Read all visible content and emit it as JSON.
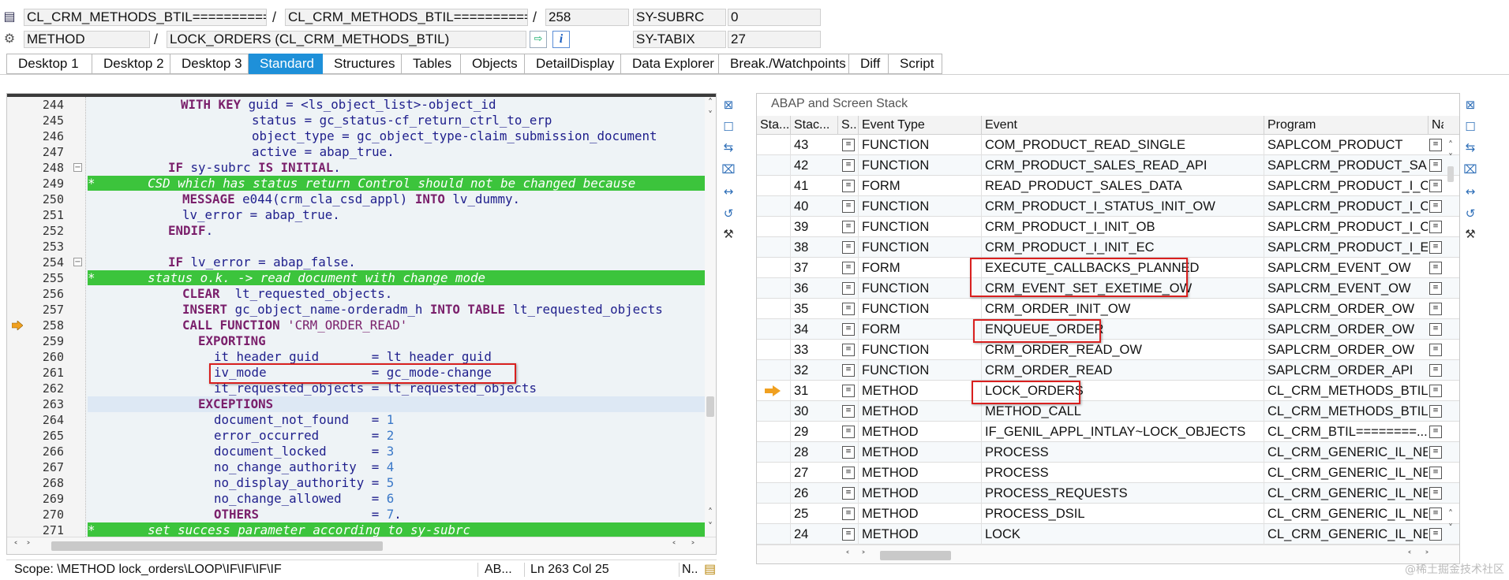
{
  "header": {
    "row1": {
      "field1": "CL_CRM_METHODS_BTIL==========...",
      "sep1": "/",
      "field2": "CL_CRM_METHODS_BTIL==========...",
      "sep2": "/",
      "field3": "258",
      "var_name": "SY-SUBRC",
      "var_value": "0"
    },
    "row2": {
      "field1": "METHOD",
      "sep1": "/",
      "field2": "LOCK_ORDERS (CL_CRM_METHODS_BTIL)",
      "info_glyph": "i",
      "var_name": "SY-TABIX",
      "var_value": "27"
    }
  },
  "tabs": [
    {
      "label": "Desktop 1"
    },
    {
      "label": "Desktop 2"
    },
    {
      "label": "Desktop 3"
    },
    {
      "label": "Standard"
    },
    {
      "label": "Structures"
    },
    {
      "label": "Tables"
    },
    {
      "label": "Objects"
    },
    {
      "label": "DetailDisplay"
    },
    {
      "label": "Data Explorer"
    },
    {
      "label": "Break./Watchpoints"
    },
    {
      "label": "Diff"
    },
    {
      "label": "Script"
    }
  ],
  "active_tab": "Standard",
  "editor": {
    "line_numbers": [
      "244",
      "245",
      "246",
      "247",
      "248",
      "249",
      "250",
      "251",
      "252",
      "253",
      "254",
      "255",
      "256",
      "257",
      "258",
      "259",
      "260",
      "261",
      "262",
      "263",
      "264",
      "265",
      "266",
      "267",
      "268",
      "269",
      "270",
      "271"
    ],
    "lines": {
      "l244": {
        "a": "WITH KEY",
        "b": " guid = <ls_object_list>-object_id"
      },
      "l245": {
        "b": "status = gc_status-cf_return_ctrl_to_erp"
      },
      "l246": {
        "b": "object_type = gc_object_type-claim_submission_document"
      },
      "l247": {
        "b": "active = abap_true."
      },
      "l248": {
        "a": "IF",
        "b": " sy-subrc ",
        "c": "IS INITIAL",
        "d": "."
      },
      "l249": {
        "b": "*       CSD which has status return Control should not be changed because"
      },
      "l250": {
        "a": "MESSAGE",
        "b": " e044(crm_cla_csd_appl) ",
        "c": "INTO",
        "d": " lv_dummy."
      },
      "l251": {
        "b": "lv_error = abap_true."
      },
      "l252": {
        "a": "ENDIF",
        "b": "."
      },
      "l254": {
        "a": "IF",
        "b": " lv_error = abap_false."
      },
      "l255": {
        "b": "*       status o.k. -> read document with change mode"
      },
      "l256": {
        "a": "CLEAR",
        "b": "  lt_requested_objects."
      },
      "l257": {
        "a": "INSERT",
        "b": " gc_object_name-orderadm_h ",
        "c": "INTO TABLE",
        "d": " lt_requested_objects"
      },
      "l258": {
        "a": "CALL FUNCTION",
        "b": " 'CRM_ORDER_READ'"
      },
      "l259": {
        "a": "EXPORTING"
      },
      "l260": {
        "b": "it_header_guid       = lt_header_guid"
      },
      "l261": {
        "b": "iv_mode              = gc_mode-change"
      },
      "l262": {
        "b": "it_requested_objects = lt_requested_objects"
      },
      "l263": {
        "a": "EXCEPTIONS"
      },
      "l264": {
        "b": "document_not_found   = ",
        "n": "1"
      },
      "l265": {
        "b": "error_occurred       = ",
        "n": "2"
      },
      "l266": {
        "b": "document_locked      = ",
        "n": "3"
      },
      "l267": {
        "b": "no_change_authority  = ",
        "n": "4"
      },
      "l268": {
        "b": "no_display_authority = ",
        "n": "5"
      },
      "l269": {
        "b": "no_change_allowed    = ",
        "n": "6"
      },
      "l270": {
        "a": "OTHERS",
        "b": "               = ",
        "n": "7",
        "d": "."
      },
      "l271": {
        "b": "*       set success parameter according to sy-subrc"
      }
    }
  },
  "statusbar": {
    "scope": "Scope: \\METHOD lock_orders\\LOOP\\IF\\IF\\IF\\IF",
    "mode": "AB...",
    "position": "Ln 263 Col  25",
    "ins": "N.."
  },
  "stack": {
    "title": "ABAP and Screen Stack",
    "columns": [
      "Sta...",
      "Stac...",
      "S...",
      "Event Type",
      "Event",
      "Program",
      "Na"
    ],
    "current_row": "31",
    "rows": [
      {
        "level": "43",
        "type": "FUNCTION",
        "event": "COM_PRODUCT_READ_SINGLE",
        "program": "SAPLCOM_PRODUCT"
      },
      {
        "level": "42",
        "type": "FUNCTION",
        "event": "CRM_PRODUCT_SALES_READ_API",
        "program": "SAPLCRM_PRODUCT_SALE..."
      },
      {
        "level": "41",
        "type": "FORM",
        "event": "READ_PRODUCT_SALES_DATA",
        "program": "SAPLCRM_PRODUCT_I_OW"
      },
      {
        "level": "40",
        "type": "FUNCTION",
        "event": "CRM_PRODUCT_I_STATUS_INIT_OW",
        "program": "SAPLCRM_PRODUCT_I_OW"
      },
      {
        "level": "39",
        "type": "FUNCTION",
        "event": "CRM_PRODUCT_I_INIT_OB",
        "program": "SAPLCRM_PRODUCT_I_OB"
      },
      {
        "level": "38",
        "type": "FUNCTION",
        "event": "CRM_PRODUCT_I_INIT_EC",
        "program": "SAPLCRM_PRODUCT_I_EC"
      },
      {
        "level": "37",
        "type": "FORM",
        "event": "EXECUTE_CALLBACKS_PLANNED",
        "program": "SAPLCRM_EVENT_OW"
      },
      {
        "level": "36",
        "type": "FUNCTION",
        "event": "CRM_EVENT_SET_EXETIME_OW",
        "program": "SAPLCRM_EVENT_OW"
      },
      {
        "level": "35",
        "type": "FUNCTION",
        "event": "CRM_ORDER_INIT_OW",
        "program": "SAPLCRM_ORDER_OW"
      },
      {
        "level": "34",
        "type": "FORM",
        "event": "ENQUEUE_ORDER",
        "program": "SAPLCRM_ORDER_OW"
      },
      {
        "level": "33",
        "type": "FUNCTION",
        "event": "CRM_ORDER_READ_OW",
        "program": "SAPLCRM_ORDER_OW"
      },
      {
        "level": "32",
        "type": "FUNCTION",
        "event": "CRM_ORDER_READ",
        "program": "SAPLCRM_ORDER_API"
      },
      {
        "level": "31",
        "type": "METHOD",
        "event": "LOCK_ORDERS",
        "program": "CL_CRM_METHODS_BTIL=..."
      },
      {
        "level": "30",
        "type": "METHOD",
        "event": "METHOD_CALL",
        "program": "CL_CRM_METHODS_BTIL=..."
      },
      {
        "level": "29",
        "type": "METHOD",
        "event": "IF_GENIL_APPL_INTLAY~LOCK_OBJECTS",
        "program": "CL_CRM_BTIL========..."
      },
      {
        "level": "28",
        "type": "METHOD",
        "event": "PROCESS",
        "program": "CL_CRM_GENERIC_IL_NE..."
      },
      {
        "level": "27",
        "type": "METHOD",
        "event": "PROCESS",
        "program": "CL_CRM_GENERIC_IL_NE..."
      },
      {
        "level": "26",
        "type": "METHOD",
        "event": "PROCESS_REQUESTS",
        "program": "CL_CRM_GENERIC_IL_NE..."
      },
      {
        "level": "25",
        "type": "METHOD",
        "event": "PROCESS_DSIL",
        "program": "CL_CRM_GENERIC_IL_NE..."
      },
      {
        "level": "24",
        "type": "METHOD",
        "event": "LOCK",
        "program": "CL_CRM_GENERIC_IL_NE..."
      }
    ]
  },
  "watermark": "@稀土掘金技术社区",
  "colors": {
    "accent_tab": "#1e90d9",
    "comment_band": "#3cc43c",
    "highlight_box": "#d9201f",
    "exec_arrow": "#f0a020",
    "keyword": "#7a1f6b",
    "number": "#3a78c8"
  }
}
